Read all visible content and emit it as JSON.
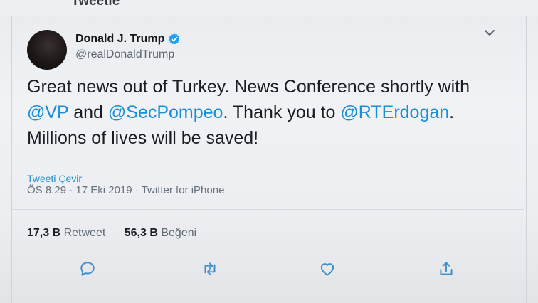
{
  "header": {
    "title": "Tweetle"
  },
  "tweet": {
    "author": {
      "display_name": "Donald J. Trump",
      "handle": "@realDonaldTrump",
      "verified": true
    },
    "text": {
      "part1": "Great news out of Turkey. News Conference shortly with",
      "mention1": "@VP",
      "part2": " and ",
      "mention2": "@SecPompeo",
      "part3": ". Thank you to ",
      "mention3": "@RTErdogan",
      "part4": ".",
      "line3": "Millions of lives will be saved!"
    },
    "translate_label": "Tweeti Çevir",
    "time": "ÖS 8:29",
    "date": "17 Eki 2019",
    "source": "Twitter for iPhone",
    "separator": " · ",
    "stats": {
      "retweets_count": "17,3 B",
      "retweets_label": "Retweet",
      "likes_count": "56,3 B",
      "likes_label": "Beğeni"
    },
    "actions": [
      "reply-icon",
      "retweet-icon",
      "like-icon",
      "share-icon"
    ]
  },
  "colors": {
    "link": "#1b8fd6",
    "verified": "#1da1f2",
    "text": "#1a1d21",
    "secondary": "#66717d"
  }
}
